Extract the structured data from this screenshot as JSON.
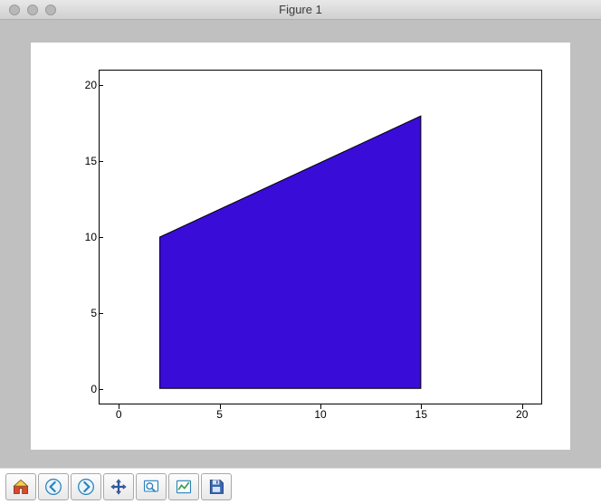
{
  "window": {
    "title": "Figure 1"
  },
  "chart_data": {
    "type": "area",
    "title": "",
    "xlabel": "",
    "ylabel": "",
    "xlim": [
      -1,
      21
    ],
    "ylim": [
      -1,
      21
    ],
    "xticks": [
      0,
      5,
      10,
      15,
      20
    ],
    "yticks": [
      0,
      5,
      10,
      15,
      20
    ],
    "polygon": [
      {
        "x": 2,
        "y": 0
      },
      {
        "x": 2,
        "y": 10
      },
      {
        "x": 15,
        "y": 18
      },
      {
        "x": 15,
        "y": 0
      }
    ],
    "fill_color": "#3a0cd8"
  },
  "toolbar": {
    "items": [
      {
        "name": "home",
        "label": "Home"
      },
      {
        "name": "back",
        "label": "Back"
      },
      {
        "name": "forward",
        "label": "Forward"
      },
      {
        "name": "pan",
        "label": "Pan"
      },
      {
        "name": "zoom",
        "label": "Zoom"
      },
      {
        "name": "subplots",
        "label": "Configure subplots"
      },
      {
        "name": "save",
        "label": "Save"
      }
    ]
  }
}
